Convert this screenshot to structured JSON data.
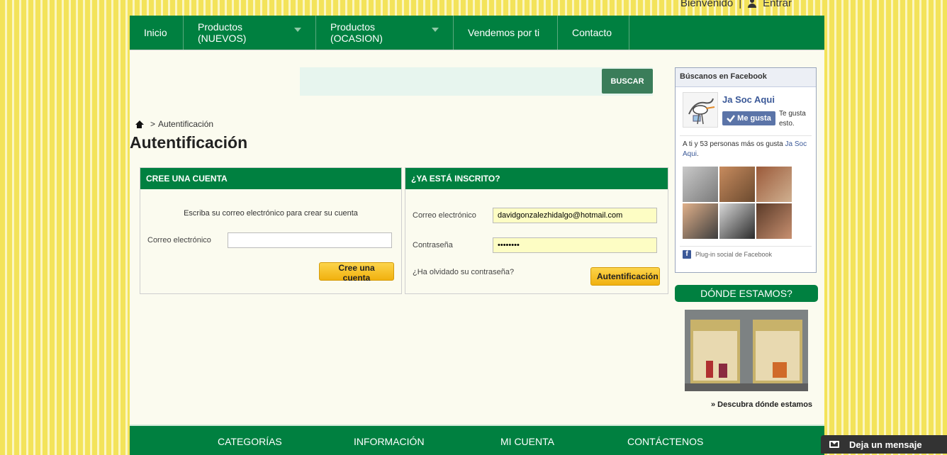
{
  "topbar": {
    "welcome": "Bienvenido",
    "separator": "|",
    "login": "Entrar"
  },
  "nav": {
    "items": [
      {
        "label": "Inicio"
      },
      {
        "label": "Productos (NUEVOS)"
      },
      {
        "label": "Productos (OCASION)"
      },
      {
        "label": "Vendemos por ti"
      },
      {
        "label": "Contacto"
      }
    ]
  },
  "search": {
    "button": "BUSCAR",
    "value": ""
  },
  "breadcrumb": {
    "separator": ">",
    "current": "Autentificación"
  },
  "page_title": "Autentificación",
  "create_account": {
    "title": "CREE UNA CUENTA",
    "instruction": "Escriba su correo electrónico para crear su cuenta",
    "email_label": "Correo electrónico",
    "email_value": "",
    "button": "Cree una cuenta"
  },
  "login": {
    "title": "¿YA ESTÁ INSCRITO?",
    "email_label": "Correo electrónico",
    "email_value": "davidgonzalezhidalgo@hotmail.com",
    "password_label": "Contraseña",
    "password_value": "••••••••",
    "forgot": "¿Ha olvidado su contraseña?",
    "button": "Autentificación"
  },
  "facebook": {
    "header": "Búscanos en Facebook",
    "page_name": "Ja Soc Aqui",
    "like_button": "Me gusta",
    "like_note": "Te gusta esto.",
    "people_text": "A ti y 53 personas más os gusta ",
    "people_link": "Ja Soc Aqui",
    "people_end": ".",
    "plugin": "Plug-in social de Facebook"
  },
  "location": {
    "title": "DÓNDE ESTAMOS?",
    "link": "» Descubra dónde estamos"
  },
  "footer": {
    "items": [
      "CATEGORÍAS",
      "INFORMACIÓN",
      "MI CUENTA",
      "CONTÁCTENOS"
    ]
  },
  "chat": {
    "label": "Deja un mensaje"
  },
  "colors": {
    "brand_green": "#008040",
    "button_yellow": "#f1b10f",
    "background_yellow": "#f3e35a"
  }
}
